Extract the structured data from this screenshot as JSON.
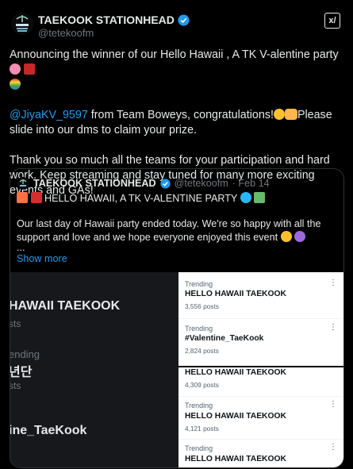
{
  "account": {
    "name": "TAEKOOK STATIONHEAD",
    "handle": "@tetekoofm"
  },
  "header": {
    "grok_label": "x/"
  },
  "tweet": {
    "line1": "Announcing the winner of our Hello Hawaii , A TK V-alentine party",
    "mention": "@JiyaKV_9597",
    "line2": " from Team Boweys, congratulations!",
    "line2b": "Please slide into our dms to claim your prize.",
    "line3": "Thank you so much all the teams for your participation and hard work. Keep streaming and stay tuned for many more exciting events and GAs!"
  },
  "quote": {
    "name": "TAEKOOK STATIONHEAD",
    "handle": "@tetekoofm",
    "date": "· Feb 14",
    "title": "HELLO HAWAII, A TK V-ALENTINE PARTY",
    "body": "Our last day of Hawaii party ended today. We're so happy with all the support and love and we hope everyone enjoyed this event",
    "ellipsis": "...",
    "show_more": "Show more"
  },
  "media_left": {
    "topic1": "HAWAII TAEKOOK",
    "posts1": "sts",
    "trending": "ending",
    "topic2": "년단",
    "posts2": "sts",
    "topic3": "ine_TaeKook"
  },
  "media_right": {
    "card1": [
      {
        "label": "Trending",
        "topic": "HELLO HAWAII TAEKOOK",
        "posts": "3,556 posts"
      },
      {
        "label": "Trending",
        "topic": "#Valentine_TaeKook",
        "posts": "2,824 posts"
      }
    ],
    "card2": [
      {
        "topic": "HELLO HAWAII TAEKOOK",
        "posts": "4,309 posts"
      },
      {
        "label": "Trending",
        "topic": "HELLO HAWAII TAEKOOK",
        "posts": "4,121 posts"
      },
      {
        "label": "Trending",
        "topic": "HELLO HAWAII TAEKOOK"
      }
    ]
  },
  "colors": {
    "accent": "#1d9bf0",
    "background": "#000000",
    "muted": "#71767b"
  }
}
